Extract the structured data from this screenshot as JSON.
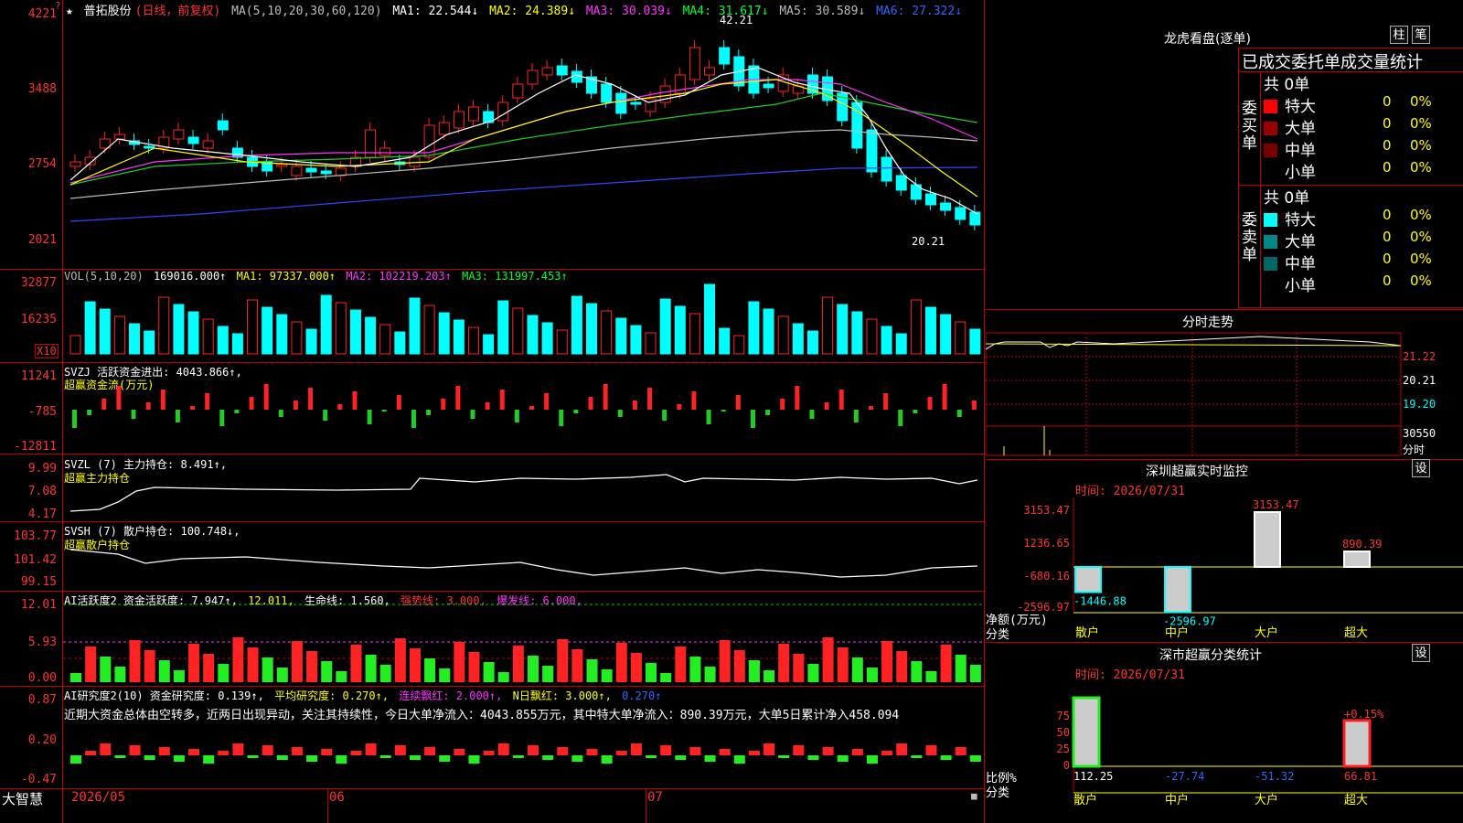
{
  "stock": {
    "name": "普拓股份",
    "period": "(日线，前复权)"
  },
  "ma": {
    "params": "MA(5,10,20,30,60,120)",
    "ma1": "MA1: 22.544↓",
    "ma2": "MA2: 24.389↓",
    "ma3": "MA3: 30.039↓",
    "ma4": "MA4: 31.617↓",
    "ma5": "MA5: 30.589↓",
    "ma6": "MA6: 27.322↓"
  },
  "price_axis": [
    "4221",
    "3488",
    "2754",
    "2021"
  ],
  "price_marks": {
    "high": "42.21",
    "low": "20.21"
  },
  "vol": {
    "params": "VOL(5,10,20)",
    "value": "169016.000↑",
    "ma1": "MA1: 97337.000↑",
    "ma2": "MA2: 102219.203↑",
    "ma3": "MA3: 131997.453↑",
    "axis": [
      "32877",
      "16235"
    ],
    "unit": "X10"
  },
  "svzj": {
    "title": "SVZJ  活跃资金进出: 4043.866↑,",
    "sub": "超赢资金流(万元)",
    "axis": [
      "11241",
      "-785",
      "-12811"
    ]
  },
  "svzl": {
    "title": "SVZL (7) 主力持仓: 8.491↑,",
    "sub": "超赢主力持仓",
    "axis": [
      "9.99",
      "7.08",
      "4.17"
    ]
  },
  "svsh": {
    "title": "SVSH (7) 散户持仓: 100.748↓,",
    "sub": "超赢散户持仓",
    "axis": [
      "103.77",
      "101.42",
      "99.15"
    ]
  },
  "ai1": {
    "title": "AI活跃度2 资金活跃度: 7.947↑,",
    "v2": "12.011,",
    "v3": "生命线: 1.560,",
    "v4": "强势线: 3.000,",
    "v5": "爆发线: 6.000,",
    "axis": [
      "12.01",
      "5.93",
      "0.00"
    ]
  },
  "ai2": {
    "title": "AI研究度2(10) 资金研究度: 0.139↑,",
    "v2": "平均研究度: 0.270↑,",
    "v3": "连续飘红: 2.000↑,",
    "v4": "N日飘红: 3.000↑,",
    "v5": "0.270↑",
    "axis": [
      "0.87",
      "0.20",
      "-0.47"
    ],
    "commentary": "近期大资金总体由空转多，近两日出现异动，关注其持续性，今日大单净流入：4043.855万元，其中特大单净流入：890.39万元，大单5日累计净入458.094"
  },
  "date_axis": [
    "2026/05",
    "06",
    "07"
  ],
  "brand": "大智慧",
  "right": {
    "dragon_title": "龙虎看盘(逐单)",
    "btn_zhu": "柱",
    "btn_bi": "笔",
    "stat_title": "已成交委托单成交量统计",
    "buy_side": "委买单",
    "sell_side": "委卖单",
    "buy_total": "共 0单",
    "sell_total": "共 0单",
    "buy_rows": [
      {
        "label": "特大",
        "v": "0",
        "p": "0%",
        "c": "#ff0000"
      },
      {
        "label": "大单",
        "v": "0",
        "p": "0%",
        "c": "#990000"
      },
      {
        "label": "中单",
        "v": "0",
        "p": "0%",
        "c": "#770000"
      },
      {
        "label": "小单",
        "v": "0",
        "p": "0%",
        "c": "#000000"
      }
    ],
    "sell_rows": [
      {
        "label": "特大",
        "v": "0",
        "p": "0%",
        "c": "#00ffff"
      },
      {
        "label": "大单",
        "v": "0",
        "p": "0%",
        "c": "#008888"
      },
      {
        "label": "中单",
        "v": "0",
        "p": "0%",
        "c": "#006666"
      },
      {
        "label": "小单",
        "v": "0",
        "p": "0%",
        "c": "#000000"
      }
    ],
    "intraday_title": "分时走势",
    "intraday_axis": [
      "21.22",
      "20.21",
      "19.20"
    ],
    "intraday_vol": "30550",
    "intraday_unit": "分时",
    "monitor_title": "深圳超赢实时监控",
    "set_label": "设",
    "monitor_time": "时间: 2026/07/31",
    "monitor_axis": [
      "3153.47",
      "1236.65",
      "-680.16",
      "-2596.97"
    ],
    "monitor_ylabel": "净额(万元)",
    "monitor_xlabel": "分类",
    "monitor_values": [
      "-1446.88",
      "-2596.97",
      "3153.47",
      "890.39"
    ],
    "categories": [
      "散户",
      "中户",
      "大户",
      "超大"
    ],
    "class_title": "深市超赢分类统计",
    "class_time": "时间: 2026/07/31",
    "class_axis": [
      "75",
      "50",
      "25",
      "0"
    ],
    "class_ylabel": "比例%",
    "class_xlabel": "分类",
    "class_values": [
      "112.25",
      "-27.74",
      "-51.32",
      "66.81"
    ],
    "class_pct": "+0.15%"
  },
  "chart_data": {
    "type": "bar",
    "title": "深圳超赢实时监控",
    "categories": [
      "散户",
      "中户",
      "大户",
      "超大"
    ],
    "values": [
      -1446.88,
      -2596.97,
      3153.47,
      890.39
    ],
    "ylabel": "净额(万元)",
    "ylim": [
      -2596.97,
      3153.47
    ]
  }
}
